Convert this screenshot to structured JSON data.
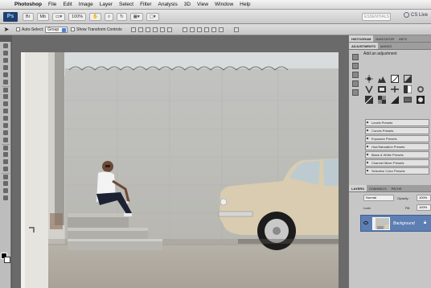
{
  "menubar": {
    "app_name": "Photoshop",
    "items": [
      "File",
      "Edit",
      "Image",
      "Layer",
      "Select",
      "Filter",
      "Analysis",
      "3D",
      "View",
      "Window",
      "Help"
    ]
  },
  "appbar": {
    "logo": "Ps",
    "zoom": "100%",
    "workspace_label": "ESSENTIALS",
    "cs_live": "CS Live"
  },
  "options_bar": {
    "auto_select_label": "Auto-Select:",
    "auto_select_value": "Group",
    "transform_label": "Show Transform Controls"
  },
  "panels": {
    "top_tabs": [
      "HISTOGRAM",
      "NAVIGATOR",
      "INFO"
    ],
    "adj_tabs": [
      "ADJUSTMENTS",
      "MASKS"
    ],
    "adj_title": "Add an adjustment",
    "presets": [
      "Levels Presets",
      "Curves Presets",
      "Exposure Presets",
      "Hue/Saturation Presets",
      "Black & White Presets",
      "Channel Mixer Presets",
      "Selective Color Presets"
    ],
    "layer_tabs": [
      "LAYERS",
      "CHANNELS",
      "PATHS"
    ],
    "blend_mode": "Normal",
    "opacity_label": "Opacity:",
    "opacity_value": "100%",
    "lock_label": "Lock:",
    "fill_label": "Fill:",
    "fill_value": "100%",
    "layer_name": "Background"
  },
  "colors": {
    "accent": "#4a7fd6",
    "layer_selected": "#5d7fb3"
  }
}
